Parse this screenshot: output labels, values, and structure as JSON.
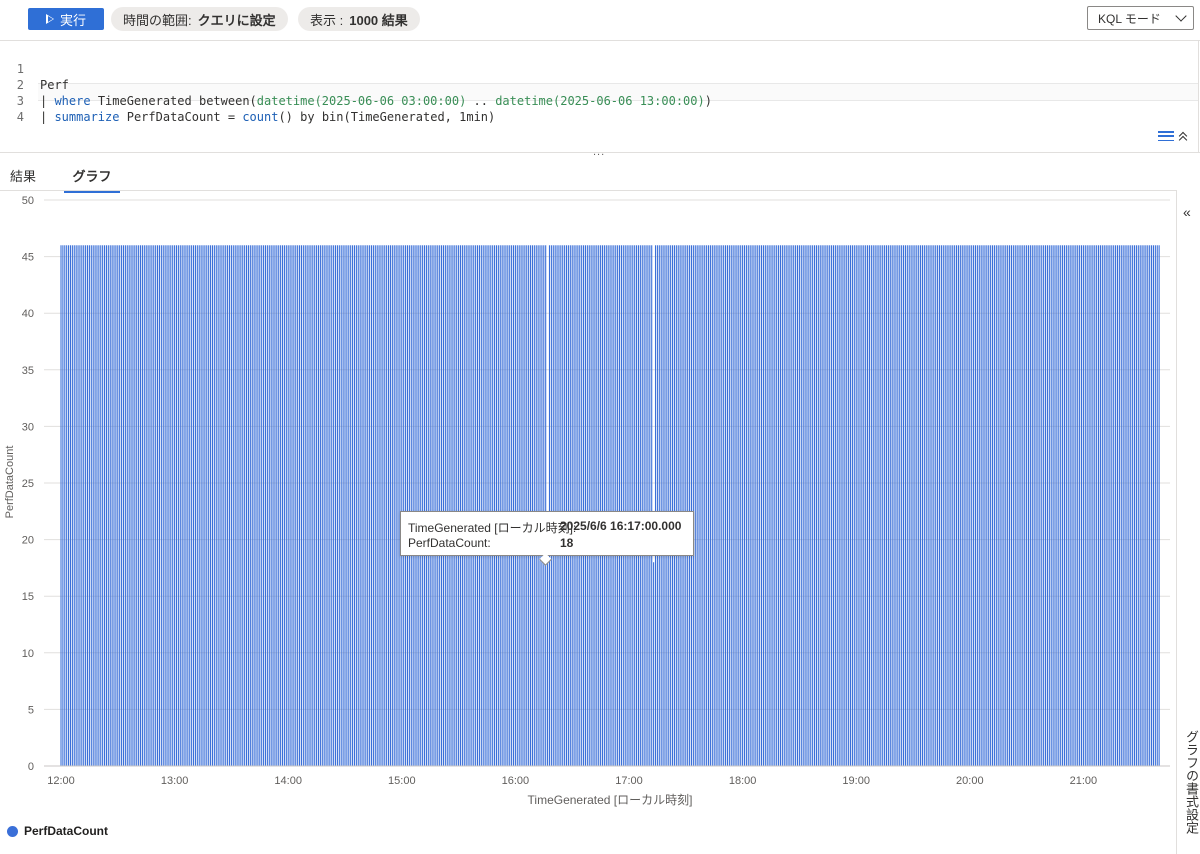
{
  "toolbar": {
    "run_label": "実行",
    "time_range_label": "時間の範囲:",
    "time_range_value": "クエリに設定",
    "show_label": "表示 :",
    "show_value": "1000 結果",
    "mode_label": "KQL モード"
  },
  "editor": {
    "lines": [
      {
        "no": "1",
        "text": "Perf"
      },
      {
        "no": "2",
        "text": "| where TimeGenerated between(datetime(2025-06-06 03:00:00) .. datetime(2025-06-06 13:00:00))"
      },
      {
        "no": "3",
        "text": "| summarize PerfDataCount = count() by bin(TimeGenerated, 1min)"
      },
      {
        "no": "4",
        "text": ""
      }
    ],
    "splitter_dots": "..."
  },
  "tabs": {
    "results": "結果",
    "chart": "グラフ"
  },
  "side_panel": {
    "label": "グラフの書式設定"
  },
  "chart_data": {
    "type": "bar",
    "xlabel": "TimeGenerated [ローカル時刻]",
    "ylabel": "PerfDataCount",
    "ylim": [
      0,
      50
    ],
    "yticks": [
      "50",
      "45",
      "40",
      "35",
      "30",
      "25",
      "20",
      "15",
      "10",
      "5",
      "0"
    ],
    "xticks": [
      "12:00",
      "13:00",
      "14:00",
      "15:00",
      "16:00",
      "17:00",
      "18:00",
      "19:00",
      "20:00",
      "21:00"
    ],
    "x_start": "12:00",
    "x_end": "21:40",
    "bin_minutes": 1,
    "typical_value": 46,
    "highlighted_points": [
      {
        "time": "16:17",
        "value": 18
      },
      {
        "time": "17:13",
        "value": 18
      }
    ],
    "series": [
      {
        "name": "PerfDataCount",
        "color": "#3a6fd8"
      }
    ],
    "grid": true,
    "legend_position": "bottom-left"
  },
  "tooltip": {
    "row1_label": "TimeGenerated [ローカル時刻]:",
    "row1_value": "2025/6/6 16:17:00.000",
    "row2_label": "PerfDataCount:",
    "row2_value": "18"
  },
  "legend": {
    "label": "PerfDataCount"
  },
  "colors": {
    "accent": "#2f6fd6",
    "bar": "#3a6fd8"
  }
}
